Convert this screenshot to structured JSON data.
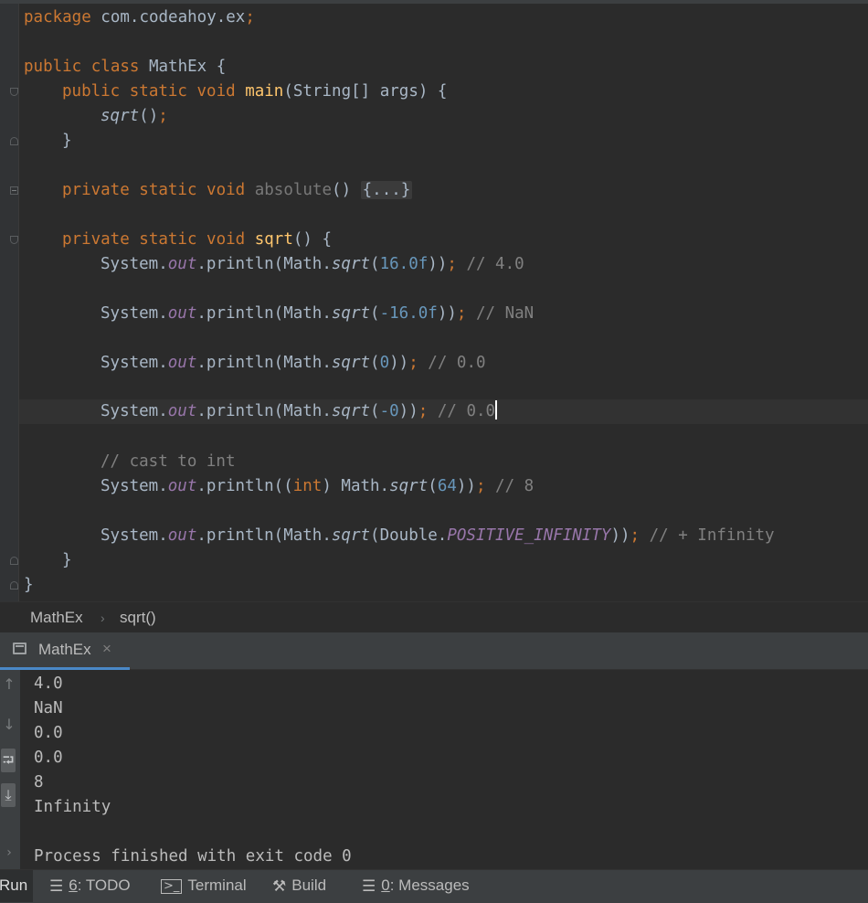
{
  "editor": {
    "lines": {
      "l1": {
        "kw": "package",
        "pkg": " com.codeahoy.ex",
        "semi": ";"
      },
      "l3": {
        "kw": "public class",
        "rest": " MathEx {"
      },
      "l4": {
        "kw": "public static void",
        "fn": "main",
        "rest": "(String[] args) {"
      },
      "l5": {
        "call": "sqrt",
        "paren": "()",
        "semi": ";"
      },
      "l6": {
        "brace": "}"
      },
      "l8": {
        "kw": "private static void",
        "name": "absolute",
        "paren": "() ",
        "fold": "{...}"
      },
      "l10": {
        "kw": "private static void",
        "fn": "sqrt",
        "rest": "() {"
      },
      "l11": {
        "a": "System.",
        "fld": "out",
        "b": ".println(Math.",
        "fn": "sqrt",
        "c": "(",
        "num": "16.0f",
        "d": "))",
        "semi": ";",
        "cm": " // 4.0"
      },
      "l13": {
        "a": "System.",
        "fld": "out",
        "b": ".println(Math.",
        "fn": "sqrt",
        "c": "(",
        "num": "-16.0f",
        "d": "))",
        "semi": ";",
        "cm": " // NaN"
      },
      "l15": {
        "a": "System.",
        "fld": "out",
        "b": ".println(Math.",
        "fn": "sqrt",
        "c": "(",
        "num": "0",
        "d": "))",
        "semi": ";",
        "cm": " // 0.0"
      },
      "l17": {
        "a": "System.",
        "fld": "out",
        "b": ".println(Math.",
        "fn": "sqrt",
        "c": "(",
        "num": "-0",
        "d": "))",
        "semi": ";",
        "cm": " // 0.0"
      },
      "l19": {
        "cm": "// cast to int"
      },
      "l20": {
        "a": "System.",
        "fld": "out",
        "b": ".println((",
        "kw": "int",
        "b2": ") Math.",
        "fn": "sqrt",
        "c": "(",
        "num": "64",
        "d": "))",
        "semi": ";",
        "cm": " // 8"
      },
      "l22": {
        "a": "System.",
        "fld": "out",
        "b": ".println(Math.",
        "fn": "sqrt",
        "c": "(Double.",
        "const": "POSITIVE_INFINITY",
        "d": "))",
        "semi": ";",
        "cm": " // + Infinity"
      },
      "l23": {
        "brace": "}"
      },
      "l24": {
        "brace": "}"
      }
    }
  },
  "breadcrumb": {
    "class_name": "MathEx",
    "separator": "›",
    "method": "sqrt()"
  },
  "run_panel": {
    "tab_label": "MathEx",
    "close_glyph": "×",
    "output": [
      "4.0",
      "NaN",
      "0.0",
      "0.0",
      "8",
      "Infinity",
      "",
      "Process finished with exit code 0"
    ]
  },
  "statusbar": {
    "run": "Run",
    "todo_key": "6",
    "todo_label": ": TODO",
    "terminal": "Terminal",
    "build": "Build",
    "messages_key": "0",
    "messages_label": ": Messages"
  },
  "icons": {
    "up_arrow": "↑",
    "down_arrow": "↓",
    "soft_wrap": "⮒",
    "scroll_end": "⤓",
    "expand": "›"
  }
}
